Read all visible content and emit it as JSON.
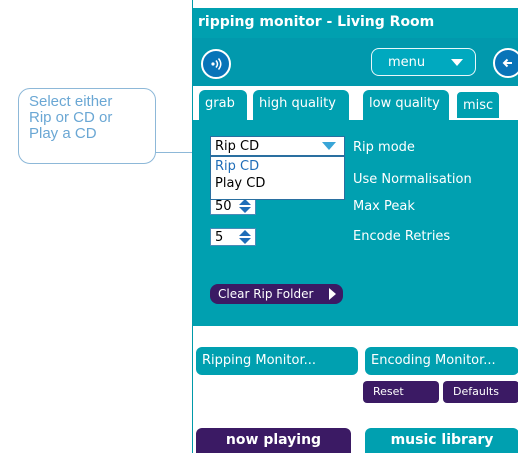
{
  "callout": {
    "lines": [
      "Select either",
      "Rip or CD or",
      "Play a CD"
    ]
  },
  "window": {
    "title": "ripping monitor - Living Room"
  },
  "toolbar": {
    "menu_label": "menu",
    "left_button_icon": "speaker-icon",
    "right_button_icon": "back-arrow-icon"
  },
  "tabs": [
    {
      "label": "grab",
      "active": false
    },
    {
      "label": "high quality",
      "active": false
    },
    {
      "label": "low quality",
      "active": false
    },
    {
      "label": "misc",
      "active": true
    }
  ],
  "settings": {
    "rip_mode": {
      "label": "Rip mode",
      "value": "Rip CD",
      "options": [
        "Rip CD",
        "Play CD"
      ],
      "open": true
    },
    "normalisation": {
      "label": "Use Normalisation"
    },
    "max_peak": {
      "label": "Max Peak",
      "value": "50"
    },
    "encode_retries": {
      "label": "Encode Retries",
      "value": "5"
    },
    "clear_button": "Clear Rip Folder"
  },
  "monitors": {
    "ripping": "Ripping Monitor...",
    "encoding": "Encoding Monitor..."
  },
  "actions": {
    "reset": "Reset",
    "defaults": "Defaults"
  },
  "bottom_tabs": {
    "now_playing": "now playing",
    "music_library": "music library"
  },
  "colors": {
    "teal": "#00a0b0",
    "purple": "#3b1a64",
    "blue": "#0874b8",
    "callout_text": "#6aa7d4"
  }
}
